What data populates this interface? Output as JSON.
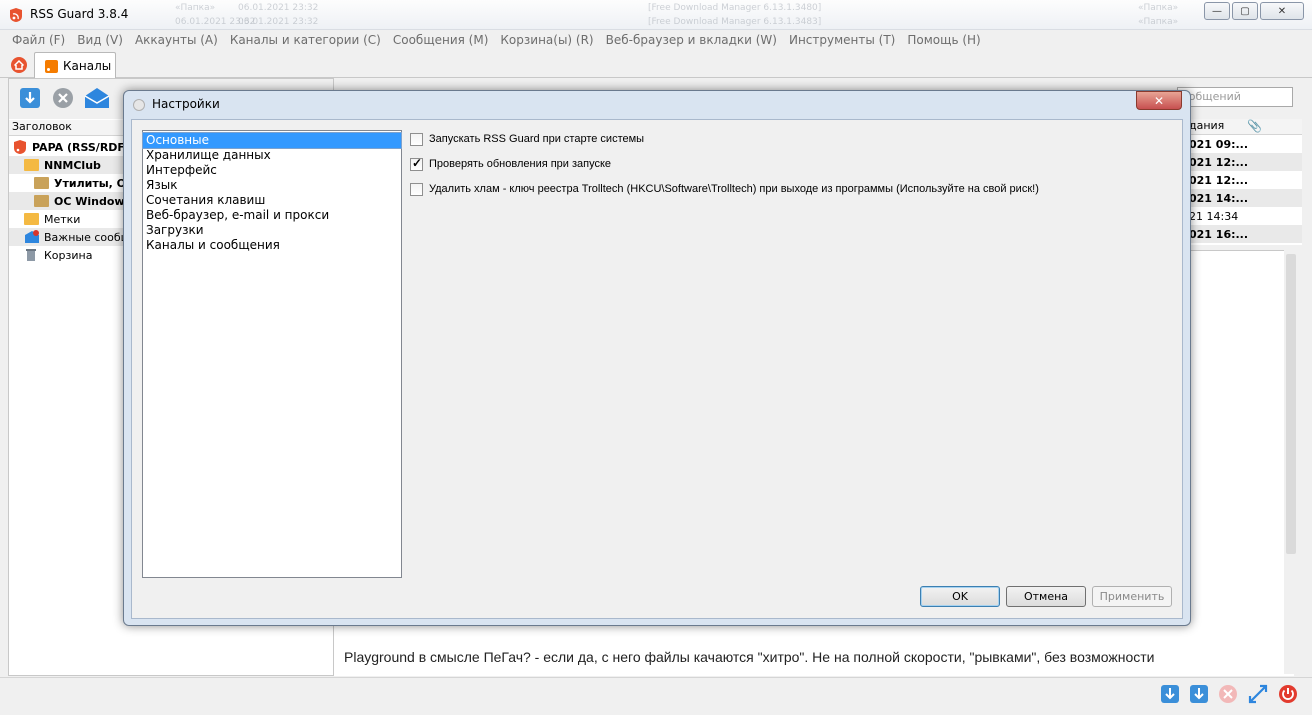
{
  "window": {
    "title": "RSS Guard 3.8.4",
    "ghost_texts": [
      "«Папка»",
      "06.01.2021 23:32",
      "[Free Download Manager 6.13.1.3480]",
      "«Папка»",
      "06.01.2021 23:32",
      "[Free Download Manager 6.13.1.3483]",
      "«Папка»",
      "06.01.2021 23:32"
    ],
    "minimize": "—",
    "maximize": "▢",
    "close": "✕"
  },
  "menu": [
    "Файл (F)",
    "Вид (V)",
    "Аккаунты (A)",
    "Каналы и категории (C)",
    "Сообщения (M)",
    "Корзина(ы) (R)",
    "Веб-браузер и вкладки (W)",
    "Инструменты (T)",
    "Помощь (H)"
  ],
  "tabs": {
    "feeds_label": "Каналы"
  },
  "feed_tree": {
    "header": "Заголовок",
    "rows": [
      {
        "label": "PAPA (RSS/RDF",
        "bold": true
      },
      {
        "label": "NNMClub",
        "bold": true
      },
      {
        "label": "Утилиты, Оф",
        "bold": true
      },
      {
        "label": "ОС Windows",
        "bold": true
      },
      {
        "label": "Метки",
        "bold": false
      },
      {
        "label": "Важные сообще",
        "bold": false
      },
      {
        "label": "Корзина",
        "bold": false
      }
    ]
  },
  "message_list": {
    "search_placeholder": "ообщений",
    "date_header": "дания",
    "rows": [
      "021 09:...",
      "021 12:...",
      "021 12:...",
      "021 14:...",
      "21 14:34",
      "021 16:..."
    ]
  },
  "preview_text": "Playground в смысле ПеГач? - если да, с него файлы качаются \"хитро\". Не на полной скорости, \"рывками\", без возможности",
  "dialog": {
    "title": "Настройки",
    "close": "✕",
    "categories": [
      "Основные",
      "Хранилище данных",
      "Интерфейс",
      "Язык",
      "Сочетания клавиш",
      "Веб-браузер, e-mail и прокси",
      "Загрузки",
      "Каналы и сообщения"
    ],
    "selected_category": "Основные",
    "options": [
      {
        "label": "Запускать RSS Guard при старте системы",
        "checked": false
      },
      {
        "label": "Проверять обновления при запуске",
        "checked": true
      },
      {
        "label": "Удалить хлам - ключ реестра Trolltech (HKCU\\Software\\Trolltech) при выходе из программы (Используйте на свой риск!)",
        "checked": false
      }
    ],
    "buttons": {
      "ok": "OK",
      "cancel": "Отмена",
      "apply": "Применить"
    }
  },
  "colors": {
    "accent": "#3399ff",
    "dialog_frame": "#d9e4f1",
    "close_red": "#c75050"
  }
}
